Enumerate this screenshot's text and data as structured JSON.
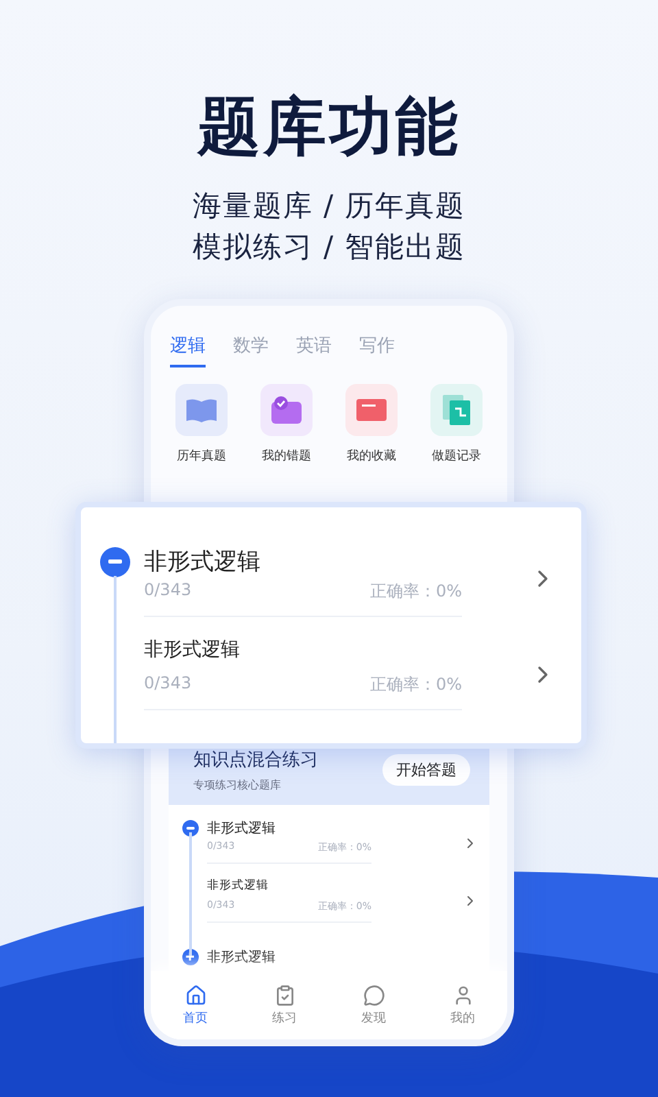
{
  "hero": {
    "title": "题库功能",
    "subtitle_lines": [
      "海量题库 / 历年真题",
      "模拟练习 / 智能出题"
    ]
  },
  "phone": {
    "tabs": [
      {
        "label": "逻辑",
        "selected": true
      },
      {
        "label": "数学",
        "selected": false
      },
      {
        "label": "英语",
        "selected": false
      },
      {
        "label": "写作",
        "selected": false
      }
    ],
    "shortcuts": [
      {
        "label": "历年真题",
        "kind": "book"
      },
      {
        "label": "我的错题",
        "kind": "folder"
      },
      {
        "label": "我的收藏",
        "kind": "card"
      },
      {
        "label": "做题记录",
        "kind": "record"
      }
    ],
    "practice_banner": {
      "title": "知识点混合练习",
      "subtitle": "专项练习核心题库",
      "button": "开始答题"
    },
    "chapters": [
      {
        "title": "非形式逻辑",
        "expanded": true,
        "progress": "0/343",
        "accuracy": "正确率：0%",
        "children": [
          {
            "title": "非形式逻辑",
            "progress": "0/343",
            "accuracy": "正确率：0%"
          }
        ]
      },
      {
        "title": "非形式逻辑",
        "expanded": false
      }
    ],
    "nav": [
      {
        "label": "首页",
        "selected": true
      },
      {
        "label": "练习",
        "selected": false
      },
      {
        "label": "发现",
        "selected": false
      },
      {
        "label": "我的",
        "selected": false
      }
    ]
  },
  "popup": {
    "chapters": [
      {
        "title": "非形式逻辑",
        "expanded": true,
        "progress": "0/343",
        "accuracy": "正确率：0%",
        "children": [
          {
            "title": "非形式逻辑",
            "progress": "0/343",
            "accuracy": "正确率：0%"
          }
        ]
      }
    ]
  }
}
